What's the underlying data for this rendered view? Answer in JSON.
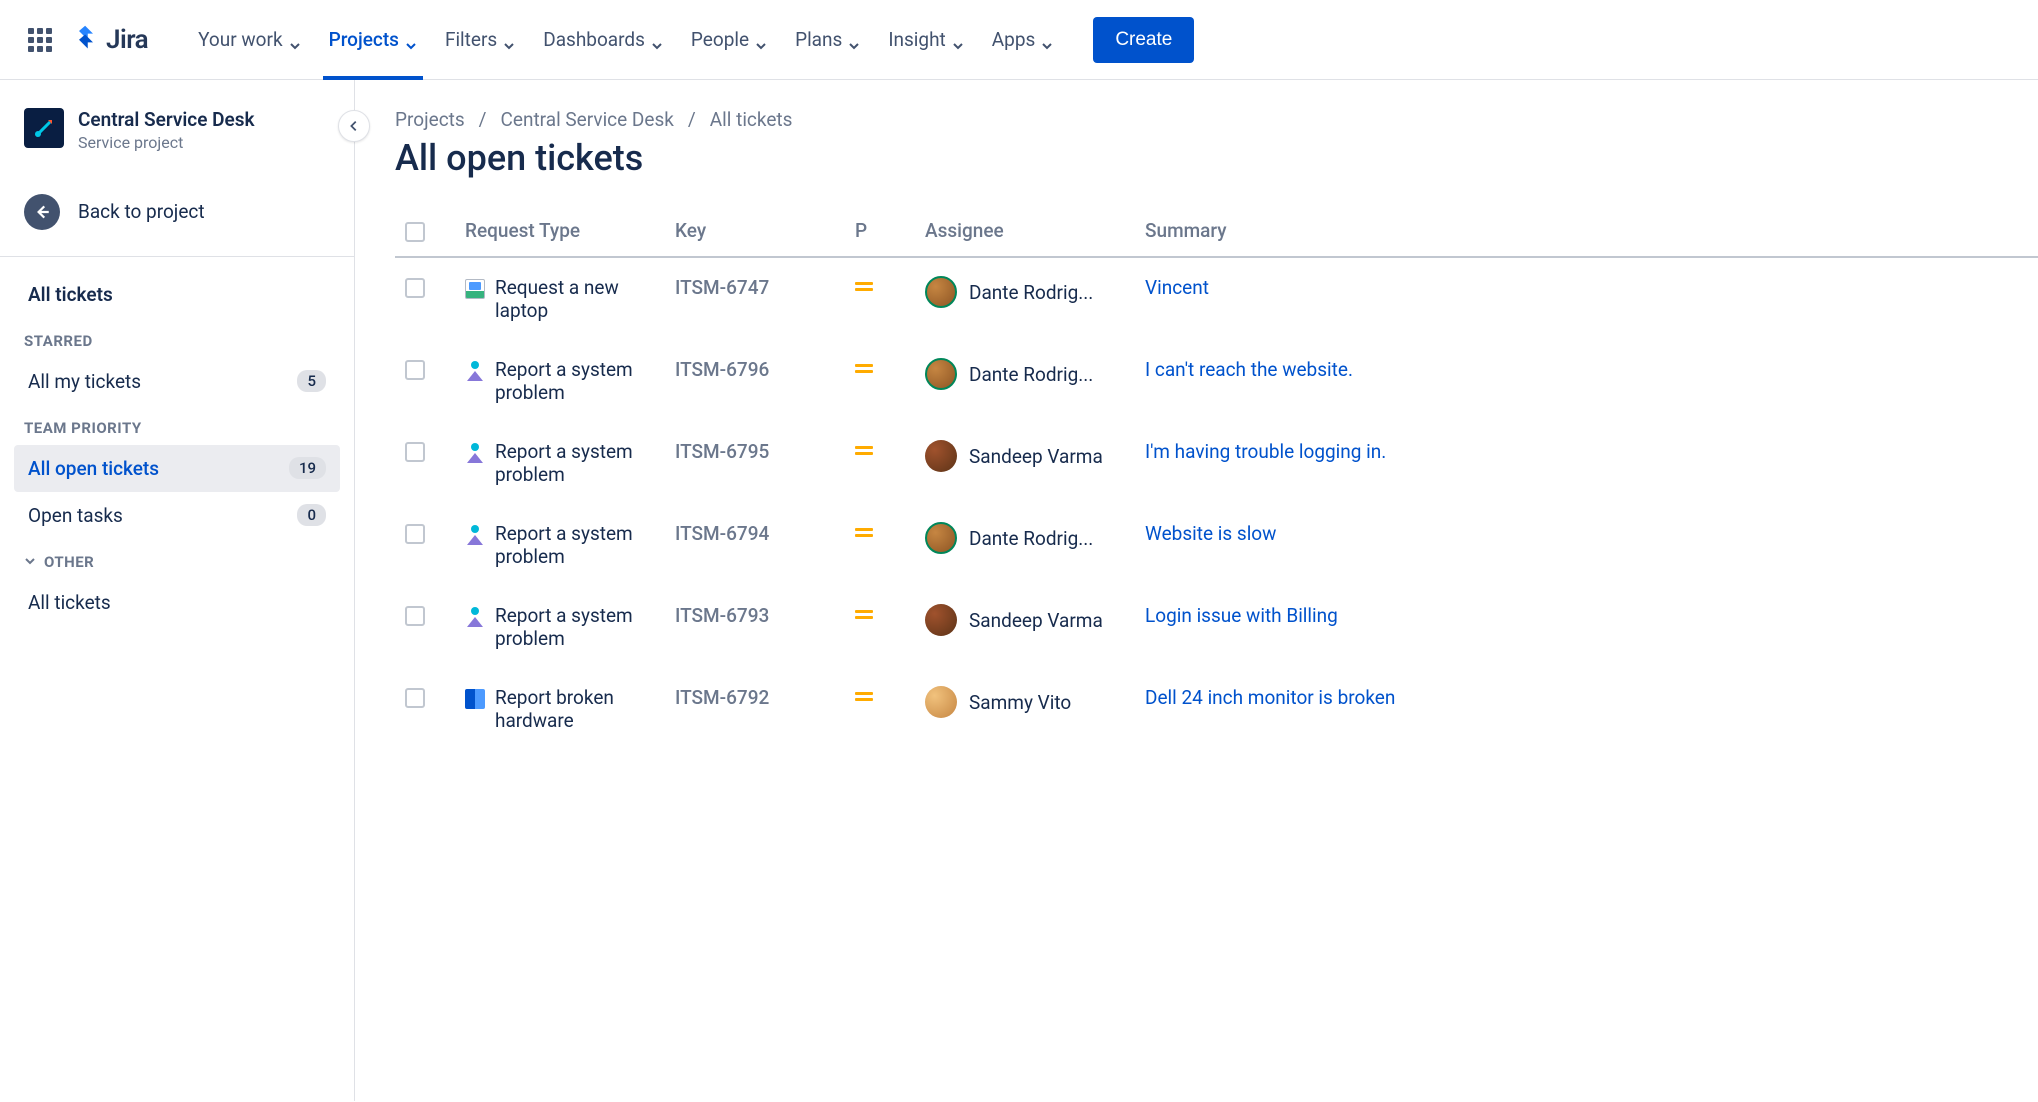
{
  "topnav": {
    "logo_text": "Jira",
    "items": [
      {
        "label": "Your work",
        "active": false
      },
      {
        "label": "Projects",
        "active": true
      },
      {
        "label": "Filters",
        "active": false
      },
      {
        "label": "Dashboards",
        "active": false
      },
      {
        "label": "People",
        "active": false
      },
      {
        "label": "Plans",
        "active": false
      },
      {
        "label": "Insight",
        "active": false
      },
      {
        "label": "Apps",
        "active": false
      }
    ],
    "create_label": "Create"
  },
  "sidebar": {
    "project_name": "Central Service Desk",
    "project_type": "Service project",
    "back_label": "Back to project",
    "all_tickets_label": "All tickets",
    "sections": {
      "starred": {
        "heading": "STARRED",
        "items": [
          {
            "label": "All my tickets",
            "badge": "5",
            "selected": false
          }
        ]
      },
      "team_priority": {
        "heading": "TEAM PRIORITY",
        "items": [
          {
            "label": "All open tickets",
            "badge": "19",
            "selected": true
          },
          {
            "label": "Open tasks",
            "badge": "0",
            "selected": false
          }
        ]
      },
      "other": {
        "heading": "OTHER",
        "items": [
          {
            "label": "All tickets",
            "badge": "",
            "selected": false
          }
        ]
      }
    }
  },
  "breadcrumb": {
    "items": [
      "Projects",
      "Central Service Desk",
      "All tickets"
    ]
  },
  "page_title": "All open tickets",
  "table": {
    "columns": [
      "",
      "Request Type",
      "Key",
      "P",
      "Assignee",
      "Summary"
    ],
    "rows": [
      {
        "request_type": "Request a new laptop",
        "rt_icon": "laptop",
        "key": "ITSM-6747",
        "assignee": "Dante Rodrig...",
        "avatar": "av1",
        "summary": "Vincent"
      },
      {
        "request_type": "Report a system problem",
        "rt_icon": "system",
        "key": "ITSM-6796",
        "assignee": "Dante Rodrig...",
        "avatar": "av1",
        "summary": "I can't reach the website."
      },
      {
        "request_type": "Report a system problem",
        "rt_icon": "system",
        "key": "ITSM-6795",
        "assignee": "Sandeep Varma",
        "avatar": "av2",
        "summary": "I'm having trouble logging in."
      },
      {
        "request_type": "Report a system problem",
        "rt_icon": "system",
        "key": "ITSM-6794",
        "assignee": "Dante Rodrig...",
        "avatar": "av1",
        "summary": "Website is slow"
      },
      {
        "request_type": "Report a system problem",
        "rt_icon": "system",
        "key": "ITSM-6793",
        "assignee": "Sandeep Varma",
        "avatar": "av2",
        "summary": "Login issue with Billing"
      },
      {
        "request_type": "Report broken hardware",
        "rt_icon": "hardware",
        "key": "ITSM-6792",
        "assignee": "Sammy Vito",
        "avatar": "av3",
        "summary": "Dell 24 inch monitor is broken"
      }
    ]
  }
}
